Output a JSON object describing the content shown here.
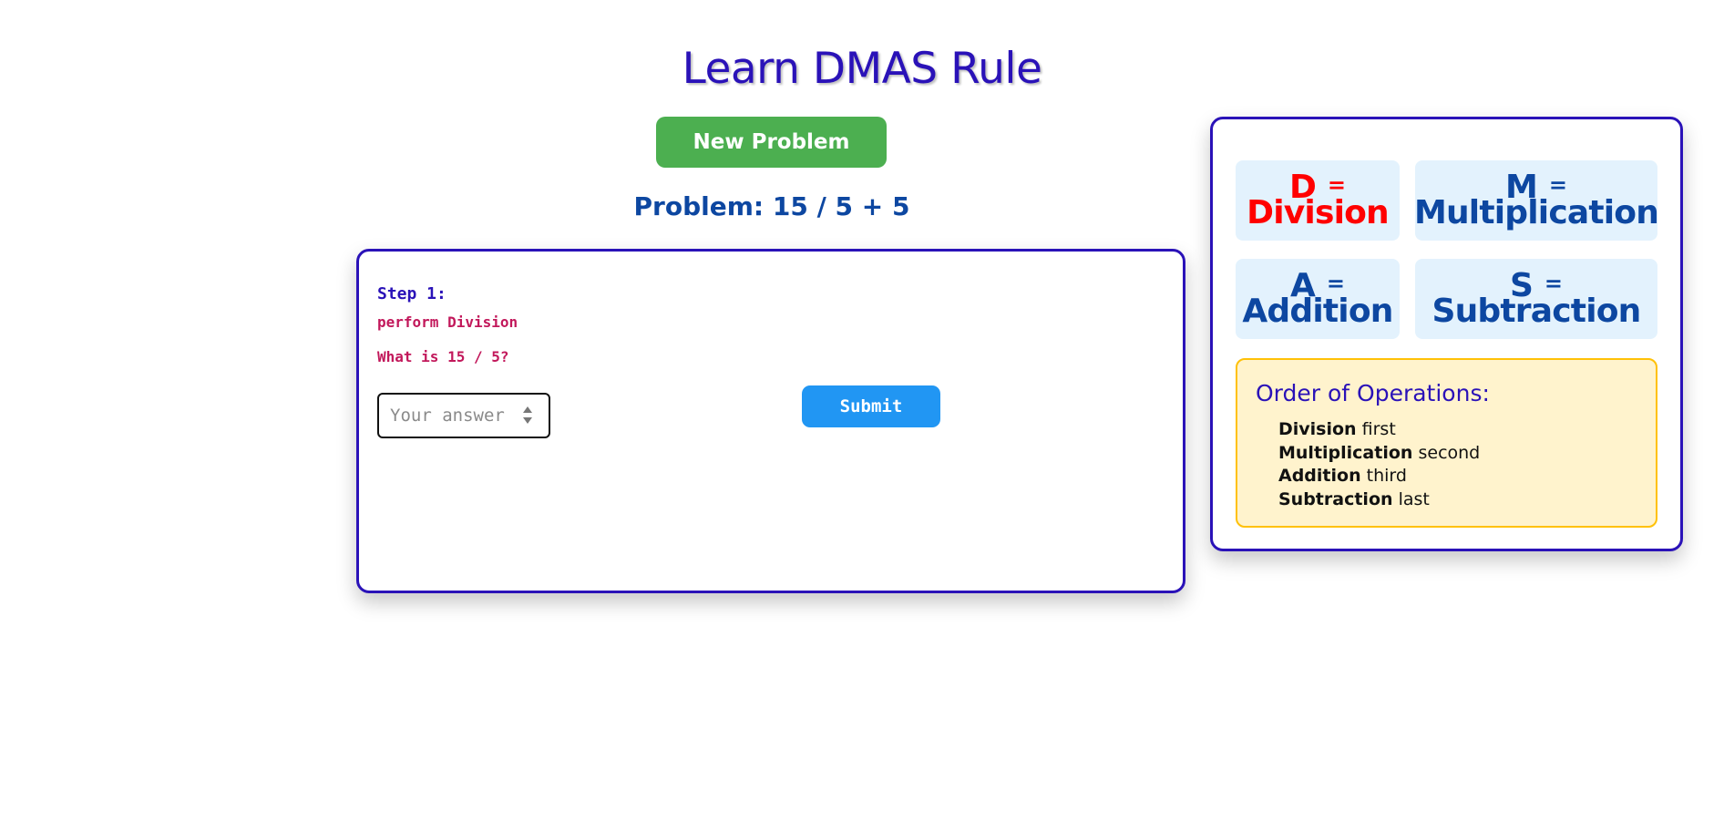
{
  "header": {
    "title": "Learn DMAS Rule"
  },
  "controls": {
    "new_problem_label": "New Problem"
  },
  "problem": {
    "label": "Problem: 15 / 5 + 5"
  },
  "step": {
    "title": "Step 1:",
    "instruction": "perform Division",
    "question": "What is 15 / 5?",
    "answer_placeholder": "Your answer",
    "answer_value": "",
    "submit_label": "Submit"
  },
  "rules": {
    "cards": [
      {
        "letter": "D",
        "equals": "=",
        "word": "Division",
        "active": true
      },
      {
        "letter": "M",
        "equals": "=",
        "word": "Multiplication",
        "active": false
      },
      {
        "letter": "A",
        "equals": "=",
        "word": "Addition",
        "active": false
      },
      {
        "letter": "S",
        "equals": "=",
        "word": "Subtraction",
        "active": false
      }
    ],
    "order": {
      "title": "Order of Operations:",
      "items": [
        {
          "op": "Division",
          "rank": "first"
        },
        {
          "op": "Multiplication",
          "rank": "second"
        },
        {
          "op": "Addition",
          "rank": "third"
        },
        {
          "op": "Subtraction",
          "rank": "last"
        }
      ]
    }
  },
  "colors": {
    "title": "#2a12b8",
    "new_problem_button": "#4caf50",
    "submit_button": "#2196f3",
    "active_rule": "#ff0000",
    "rule_text": "#0d47a1",
    "instruction_text": "#c2185b"
  }
}
